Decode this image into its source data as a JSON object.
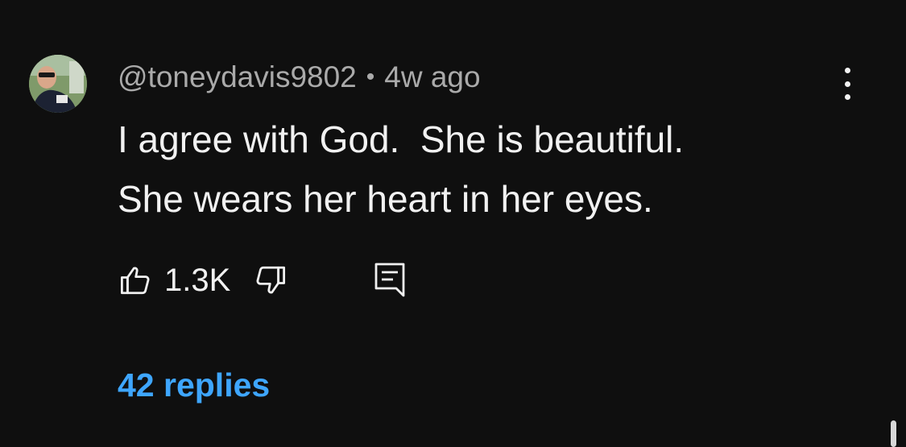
{
  "comment": {
    "author": "@toneydavis9802",
    "separator": "•",
    "time_ago": "4w ago",
    "text_lines": [
      "I agree with God.  She is beautiful.",
      "She wears her heart in her eyes."
    ],
    "like_count": "1.3K",
    "replies_label": "42 replies"
  },
  "icons": {
    "menu": "more-vertical-icon",
    "like": "thumbs-up-icon",
    "dislike": "thumbs-down-icon",
    "reply": "comment-reply-icon"
  },
  "colors": {
    "background": "#0f0f0f",
    "text_primary": "#f1f1f1",
    "text_secondary": "#aaaaaa",
    "link": "#3ea6ff"
  }
}
